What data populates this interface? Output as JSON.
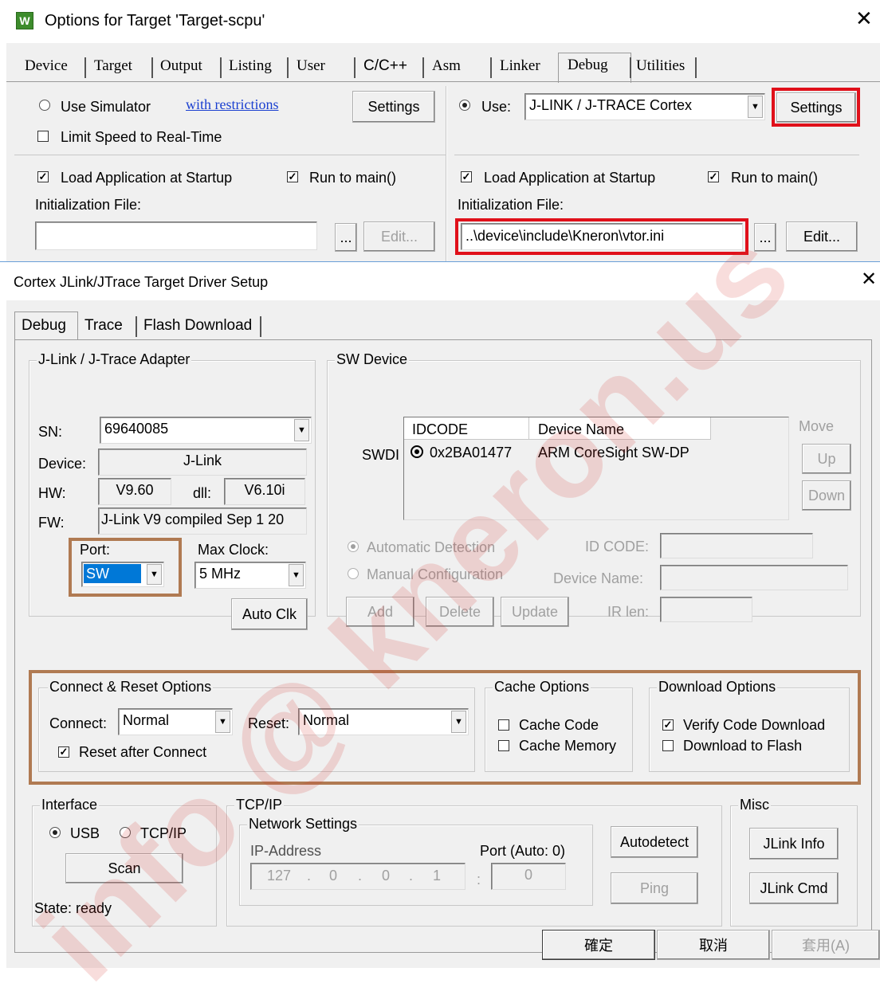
{
  "options_dialog": {
    "title": "Options for Target 'Target-scpu'",
    "tabs": [
      "Device",
      "Target",
      "Output",
      "Listing",
      "User",
      "C/C++",
      "Asm",
      "Linker",
      "Debug",
      "Utilities"
    ],
    "active_tab": "Debug",
    "left": {
      "use_simulator_label": "Use Simulator",
      "with_restrictions_link": "with restrictions",
      "settings_label": "Settings",
      "limit_speed_label": "Limit Speed to Real-Time",
      "load_app_label": "Load Application at Startup",
      "run_to_main_label": "Run to main()",
      "init_file_label": "Initialization File:",
      "init_file_value": "",
      "browse_label": "...",
      "edit_label": "Edit..."
    },
    "right": {
      "use_label": "Use:",
      "debugger_value": "J-LINK / J-TRACE Cortex",
      "settings_label": "Settings",
      "load_app_label": "Load Application at Startup",
      "run_to_main_label": "Run to main()",
      "init_file_label": "Initialization File:",
      "init_file_value": "..\\device\\include\\Kneron\\vtor.ini",
      "browse_label": "...",
      "edit_label": "Edit..."
    }
  },
  "driver_dialog": {
    "title": "Cortex JLink/JTrace Target Driver Setup",
    "tabs": [
      "Debug",
      "Trace",
      "Flash Download"
    ],
    "active_tab": "Debug",
    "adapter": {
      "group_label": "J-Link / J-Trace Adapter",
      "sn_label": "SN:",
      "sn_value": "69640085",
      "device_label": "Device:",
      "device_value": "J-Link",
      "hw_label": "HW:",
      "hw_value": "V9.60",
      "dll_label": "dll:",
      "dll_value": "V6.10i",
      "fw_label": "FW:",
      "fw_value": "J-Link V9 compiled Sep  1 20",
      "port_label": "Port:",
      "port_value": "SW",
      "max_clock_label": "Max Clock:",
      "max_clock_value": "5 MHz",
      "auto_clk_label": "Auto Clk"
    },
    "sw_device": {
      "group_label": "SW Device",
      "columns": [
        "IDCODE",
        "Device Name"
      ],
      "row_prefix": "SWDI",
      "rows": [
        {
          "idcode": "0x2BA01477",
          "device_name": "ARM CoreSight SW-DP"
        }
      ],
      "move_label": "Move",
      "up_label": "Up",
      "down_label": "Down",
      "auto_detect_label": "Automatic Detection",
      "manual_config_label": "Manual Configuration",
      "id_code_label": "ID CODE:",
      "device_name_label": "Device Name:",
      "add_label": "Add",
      "delete_label": "Delete",
      "update_label": "Update",
      "ir_len_label": "IR len:"
    },
    "connect_reset": {
      "group_label": "Connect & Reset Options",
      "connect_label": "Connect:",
      "connect_value": "Normal",
      "reset_label": "Reset:",
      "reset_value": "Normal",
      "reset_after_connect_label": "Reset after Connect"
    },
    "cache": {
      "group_label": "Cache Options",
      "cache_code_label": "Cache Code",
      "cache_memory_label": "Cache Memory"
    },
    "download": {
      "group_label": "Download Options",
      "verify_label": "Verify Code Download",
      "download_flash_label": "Download to Flash"
    },
    "interface": {
      "group_label": "Interface",
      "usb_label": "USB",
      "tcpip_label": "TCP/IP",
      "scan_label": "Scan",
      "state_label": "State: ready"
    },
    "tcpip": {
      "group_label": "TCP/IP",
      "network_label": "Network Settings",
      "ip_label": "IP-Address",
      "ip_parts": [
        "127",
        "0",
        "0",
        "1"
      ],
      "port_label": "Port (Auto: 0)",
      "port_value": "0",
      "autodetect_label": "Autodetect",
      "ping_label": "Ping"
    },
    "misc": {
      "group_label": "Misc",
      "jlink_info_label": "JLink Info",
      "jlink_cmd_label": "JLink Cmd"
    },
    "footer": {
      "ok_label": "確定",
      "cancel_label": "取消",
      "apply_label": "套用(A)"
    }
  },
  "watermark": "info @ kneron.us",
  "colors": {
    "highlight_red": "#e0101a",
    "highlight_brown": "#b07a52",
    "dialog_bg": "#f0f0f0",
    "selection_blue": "#0078d7"
  }
}
